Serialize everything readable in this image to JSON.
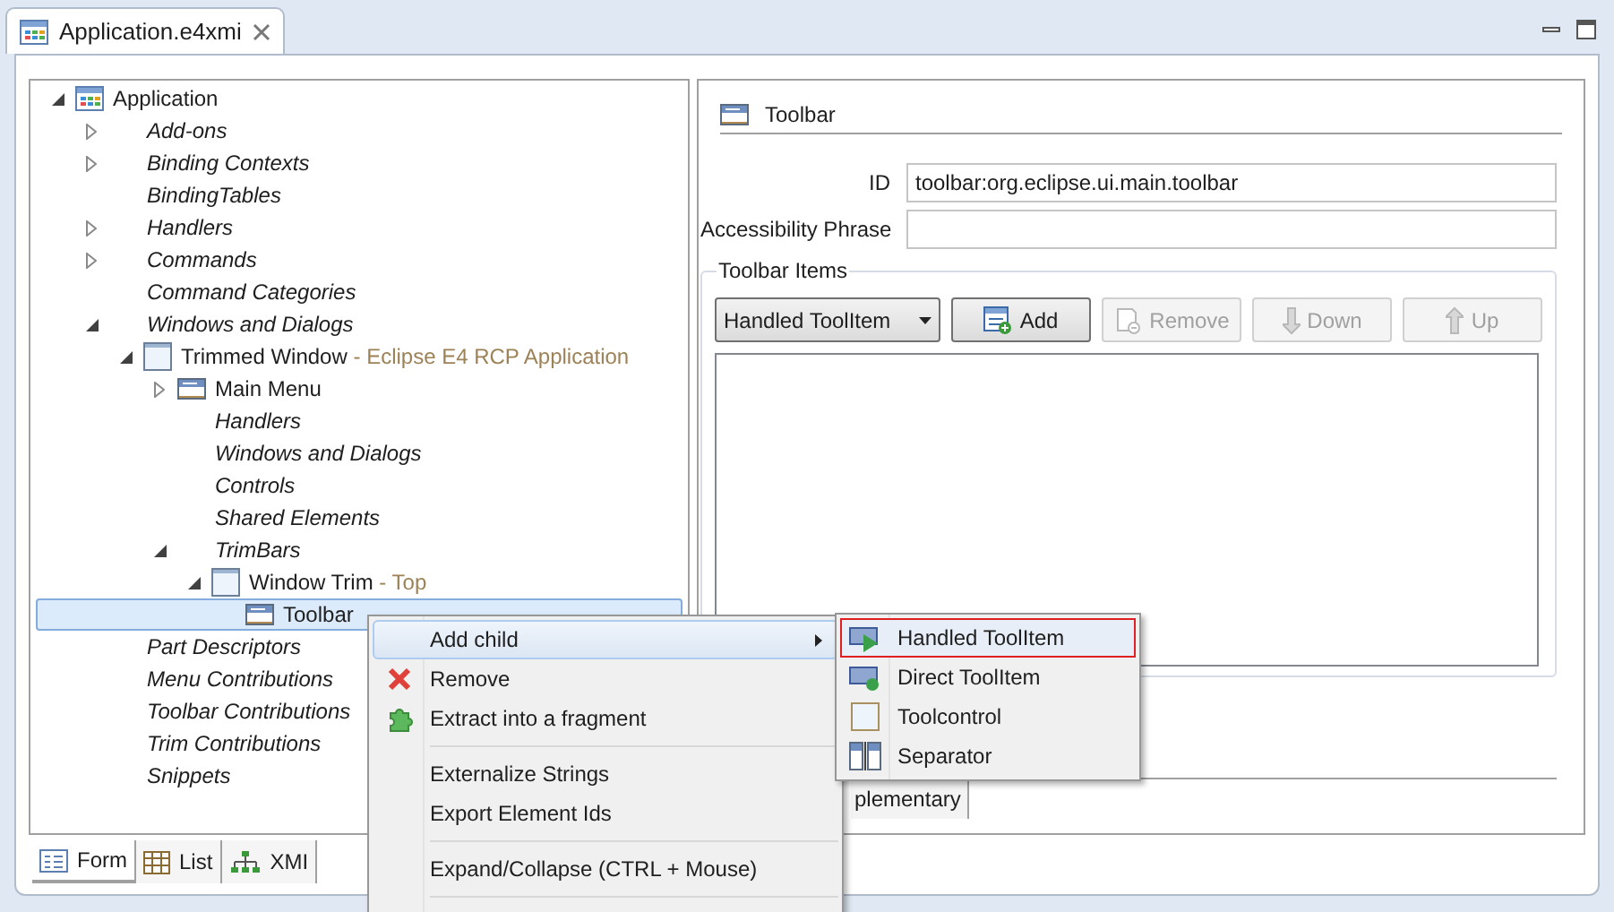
{
  "editor_tab": {
    "title": "Application.e4xmi",
    "selected": true
  },
  "tree": [
    {
      "label": "Application",
      "kind": "application",
      "expanded": true,
      "selected": false,
      "children": [
        {
          "label": "Add-ons",
          "kind": "folder",
          "expanded": false,
          "selected": false
        },
        {
          "label": "Binding Contexts",
          "kind": "folder",
          "expanded": false,
          "selected": false
        },
        {
          "label": "BindingTables",
          "kind": "folder",
          "selected": false
        },
        {
          "label": "Handlers",
          "kind": "folder",
          "expanded": false,
          "selected": false
        },
        {
          "label": "Commands",
          "kind": "folder",
          "expanded": false,
          "selected": false
        },
        {
          "label": "Command Categories",
          "kind": "folder",
          "selected": false
        },
        {
          "label": "Windows and Dialogs",
          "kind": "folder",
          "expanded": true,
          "selected": false,
          "children": [
            {
              "label": "Trimmed Window",
              "suffix": " - Eclipse E4 RCP Application",
              "kind": "window",
              "expanded": true,
              "selected": false,
              "children": [
                {
                  "label": "Main Menu",
                  "kind": "menu",
                  "expanded": false,
                  "selected": false
                },
                {
                  "label": "Handlers",
                  "kind": "folder",
                  "selected": false
                },
                {
                  "label": "Windows and Dialogs",
                  "kind": "folder",
                  "selected": false
                },
                {
                  "label": "Controls",
                  "kind": "folder",
                  "selected": false
                },
                {
                  "label": "Shared Elements",
                  "kind": "folder",
                  "selected": false
                },
                {
                  "label": "TrimBars",
                  "kind": "folder",
                  "expanded": true,
                  "selected": false,
                  "children": [
                    {
                      "label": "Window Trim",
                      "suffix": " - Top",
                      "kind": "window",
                      "expanded": true,
                      "selected": false,
                      "children": [
                        {
                          "label": "Toolbar",
                          "kind": "toolbar",
                          "selected": true
                        }
                      ]
                    }
                  ]
                }
              ]
            }
          ]
        },
        {
          "label": "Part Descriptors",
          "kind": "folder",
          "selected": false
        },
        {
          "label": "Menu Contributions",
          "kind": "folder",
          "selected": false
        },
        {
          "label": "Toolbar Contributions",
          "kind": "folder",
          "selected": false
        },
        {
          "label": "Trim Contributions",
          "kind": "folder",
          "selected": false
        },
        {
          "label": "Snippets",
          "kind": "folder",
          "selected": false
        }
      ]
    }
  ],
  "detail": {
    "title": "Toolbar",
    "fields": [
      {
        "label": "ID",
        "value": "toolbar:org.eclipse.ui.main.toolbar"
      },
      {
        "label": "Accessibility Phrase"
      }
    ],
    "toolbar_items": {
      "title": "Toolbar Items",
      "type_select": "Handled ToolItem",
      "buttons": [
        {
          "label": "Add",
          "kind": "add",
          "disabled": false
        },
        {
          "label": "Remove",
          "kind": "remove",
          "disabled": true
        },
        {
          "label": "Down",
          "kind": "down",
          "disabled": true
        },
        {
          "label": "Up",
          "kind": "up",
          "disabled": true
        }
      ]
    },
    "tabs": [
      {
        "label": "plementary",
        "selected": false
      }
    ]
  },
  "view_tabs": [
    {
      "label": "Form",
      "kind": "form",
      "selected": true
    },
    {
      "label": "List",
      "kind": "list",
      "selected": false
    },
    {
      "label": "XMI",
      "kind": "xmi",
      "selected": false
    }
  ],
  "context_menu": {
    "items": [
      {
        "label": "Add child",
        "kind": "submenu",
        "selected": true
      },
      {
        "label": "Remove",
        "kind": "remove",
        "selected": false
      },
      {
        "label": "Extract into a fragment",
        "kind": "extract",
        "selected": false
      },
      {
        "kind": "separator"
      },
      {
        "label": "Externalize Strings",
        "kind": "plain",
        "selected": false
      },
      {
        "label": "Export Element Ids",
        "kind": "plain",
        "selected": false
      },
      {
        "kind": "separator"
      },
      {
        "label": "Expand/Collapse (CTRL + Mouse)",
        "kind": "plain",
        "selected": false
      },
      {
        "kind": "separator"
      }
    ]
  },
  "submenu": {
    "items": [
      {
        "label": "Handled ToolItem",
        "kind": "handled",
        "selected": true
      },
      {
        "label": "Direct ToolItem",
        "kind": "direct",
        "selected": false
      },
      {
        "label": "Toolcontrol",
        "kind": "control",
        "selected": false
      },
      {
        "label": "Separator",
        "kind": "separator",
        "selected": false
      }
    ]
  }
}
